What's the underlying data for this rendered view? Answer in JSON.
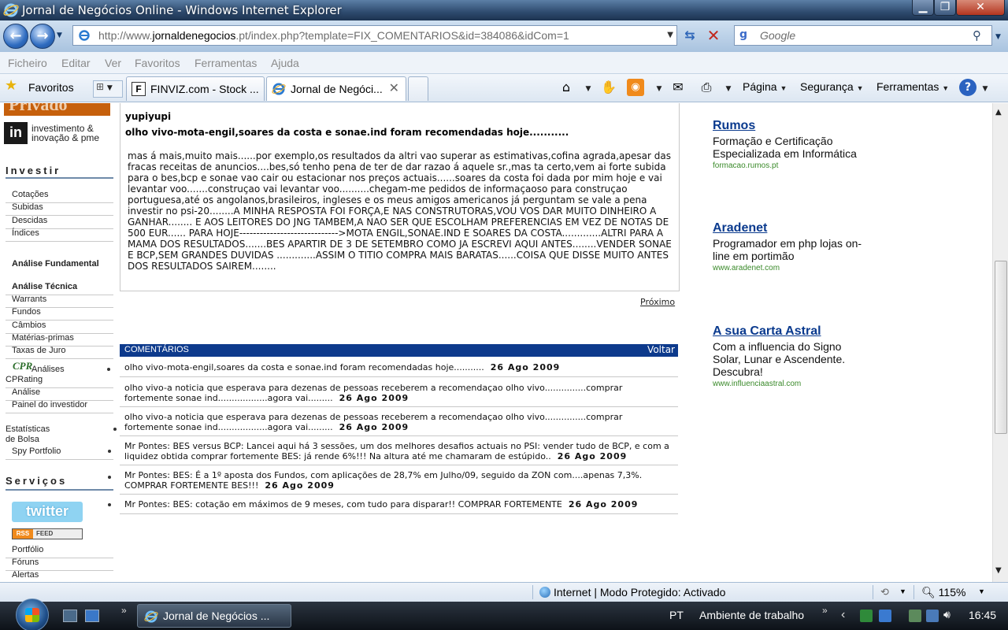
{
  "window": {
    "title": "Jornal de Negócios Online - Windows Internet Explorer",
    "min_label": "▁",
    "max_label": "❐",
    "close_label": "✕"
  },
  "address_bar": {
    "url_prefix": "http://www.",
    "url_domain": "jornaldenegocios",
    "url_rest": ".pt/index.php?template=FIX_COMENTARIOS&id=384086&idCom=1",
    "search_placeholder": "Google"
  },
  "menu": [
    "Ficheiro",
    "Editar",
    "Ver",
    "Favoritos",
    "Ferramentas",
    "Ajuda"
  ],
  "favorites_label": "Favoritos",
  "tabs": [
    {
      "label": "FINVIZ.com - Stock ...",
      "icon": "F"
    },
    {
      "label": "Jornal de Negóci...",
      "icon": "e",
      "active": true
    }
  ],
  "commands": {
    "page": "Página",
    "security": "Segurança",
    "tools": "Ferramentas"
  },
  "leftnav": {
    "logo_top": "Privado",
    "logo_in": "in",
    "logo_in_line1": "investimento &",
    "logo_in_line2": "inovação & pme",
    "investir_head": "Investir",
    "investir_items": [
      "Cotações",
      "Subidas",
      "Descidas",
      "Índices"
    ],
    "analise_fundamental": "Análise Fundamental",
    "analise_items": [
      "Análise Técnica",
      "Warrants",
      "Fundos",
      "Câmbios",
      "Matérias-primas",
      "Taxas de Juro"
    ],
    "cpr_icon": "CPR",
    "cprating_line1": "Análises",
    "cprating_line2": "CPRating",
    "analise": "Análise",
    "painel": "Painel do investidor",
    "estatisticas_line1": "Estatísticas",
    "estatisticas_line2": "de Bolsa",
    "spy": "Spy Portfolio",
    "servicos_head": "Serviços",
    "twitter": "twitter",
    "rss": "RSS",
    "feed": "FEED",
    "servicos_items": [
      "Portfólio",
      "Fóruns",
      "Alertas"
    ]
  },
  "article": {
    "author": "yupiyupi",
    "title": "olho vivo-mota-engil,soares da costa e sonae.ind foram recomendadas hoje...........",
    "body": "mas á mais,muito mais......por exemplo,os resultados da altri vao superar as estimativas,cofina agrada,apesar das fracas receitas de anuncios....bes,só tenho pena de ter de dar razao á aquele sr.,mas ta certo,vem ai forte subida para o bes,bcp e sonae vao cair ou estacionar nos preços actuais......soares da costa foi dada por mim hoje e vai levantar voo.......construçao vai levantar voo..........chegam-me pedidos de informaçaoso para construçao portuguesa,até os angolanos,brasileiros, ingleses e os meus amigos americanos já perguntam se vale a pena investir no psi-20........A MINHA RESPOSTA FOI FORÇA,E NAS CONSTRUTORAS,VOU VOS DAR MUITO DINHEIRO A GANHAR........ E AOS LEITORES DO JNG TAMBEM,A NAO SER QUE ESCOLHAM PREFERENCIAS EM VEZ DE NOTAS DE 500 EUR...... PARA HOJE----------------------------->MOTA ENGIL,SONAE.IND E SOARES DA COSTA.............ALTRI PARA A MAMA DOS RESULTADOS.......BES APARTIR DE 3 DE SETEMBRO COMO JA ESCREVI AQUI ANTES........VENDER SONAE E BCP,SEM GRANDES DUVIDAS .............ASSIM O TITIO COMPRA MAIS BARATAS......COISA QUE DISSE MUITO ANTES DOS RESULTADOS SAIREM........",
    "next": "Próximo"
  },
  "comments": {
    "header": "COMENTÁRIOS",
    "back": "Voltar",
    "items": [
      {
        "text": "olho vivo-mota-engil,soares da costa e sonae.ind foram recomendadas hoje...........",
        "date": "26  Ago  2009"
      },
      {
        "text": "olho vivo-a noticia que esperava para dezenas de pessoas receberem a recomendaçao olho vivo...............comprar fortemente sonae ind..................agora vai.........",
        "date": "26  Ago  2009"
      },
      {
        "text": "olho vivo-a noticia que esperava para dezenas de pessoas receberem a recomendaçao olho vivo...............comprar fortemente sonae ind..................agora vai.........",
        "date": "26  Ago  2009"
      },
      {
        "text": "Mr Pontes: BES versus BCP: Lancei aqui há 3 sessões, um dos melhores desafios actuais no PSI: vender tudo de BCP, e com a liquidez obtida comprar fortemente BES: já rende 6%!!! Na altura até me chamaram de estúpido..",
        "date": "26  Ago  2009"
      },
      {
        "text": "Mr Pontes: BES: É a 1º aposta dos Fundos, com aplicações de 28,7% em Julho/09, seguido da ZON com....apenas 7,3%. COMPRAR FORTEMENTE BES!!!",
        "date": "26  Ago  2009"
      },
      {
        "text": "Mr Pontes: BES: cotação em máximos de 9 meses, com tudo para disparar!! COMPRAR FORTEMENTE",
        "date": "26  Ago  2009"
      }
    ]
  },
  "ads": [
    {
      "title": "Rumos",
      "desc": "Formação e Certificação Especializada em Informática",
      "url": "formacao.rumos.pt"
    },
    {
      "title": "Aradenet",
      "desc": "Programador em php lojas on-line em portimão",
      "url": "www.aradenet.com"
    },
    {
      "title": "A sua Carta Astral",
      "desc": "Com a influencia do Signo Solar, Lunar e Ascendente. Descubra!",
      "url": "www.influenciaastral.com"
    }
  ],
  "status": {
    "zone": "Internet | Modo Protegido: Activado",
    "zoom": "115%"
  },
  "taskbar": {
    "task_label": "Jornal de Negócios ...",
    "lang": "PT",
    "desktop": "Ambiente de trabalho",
    "clock": "16:45"
  }
}
